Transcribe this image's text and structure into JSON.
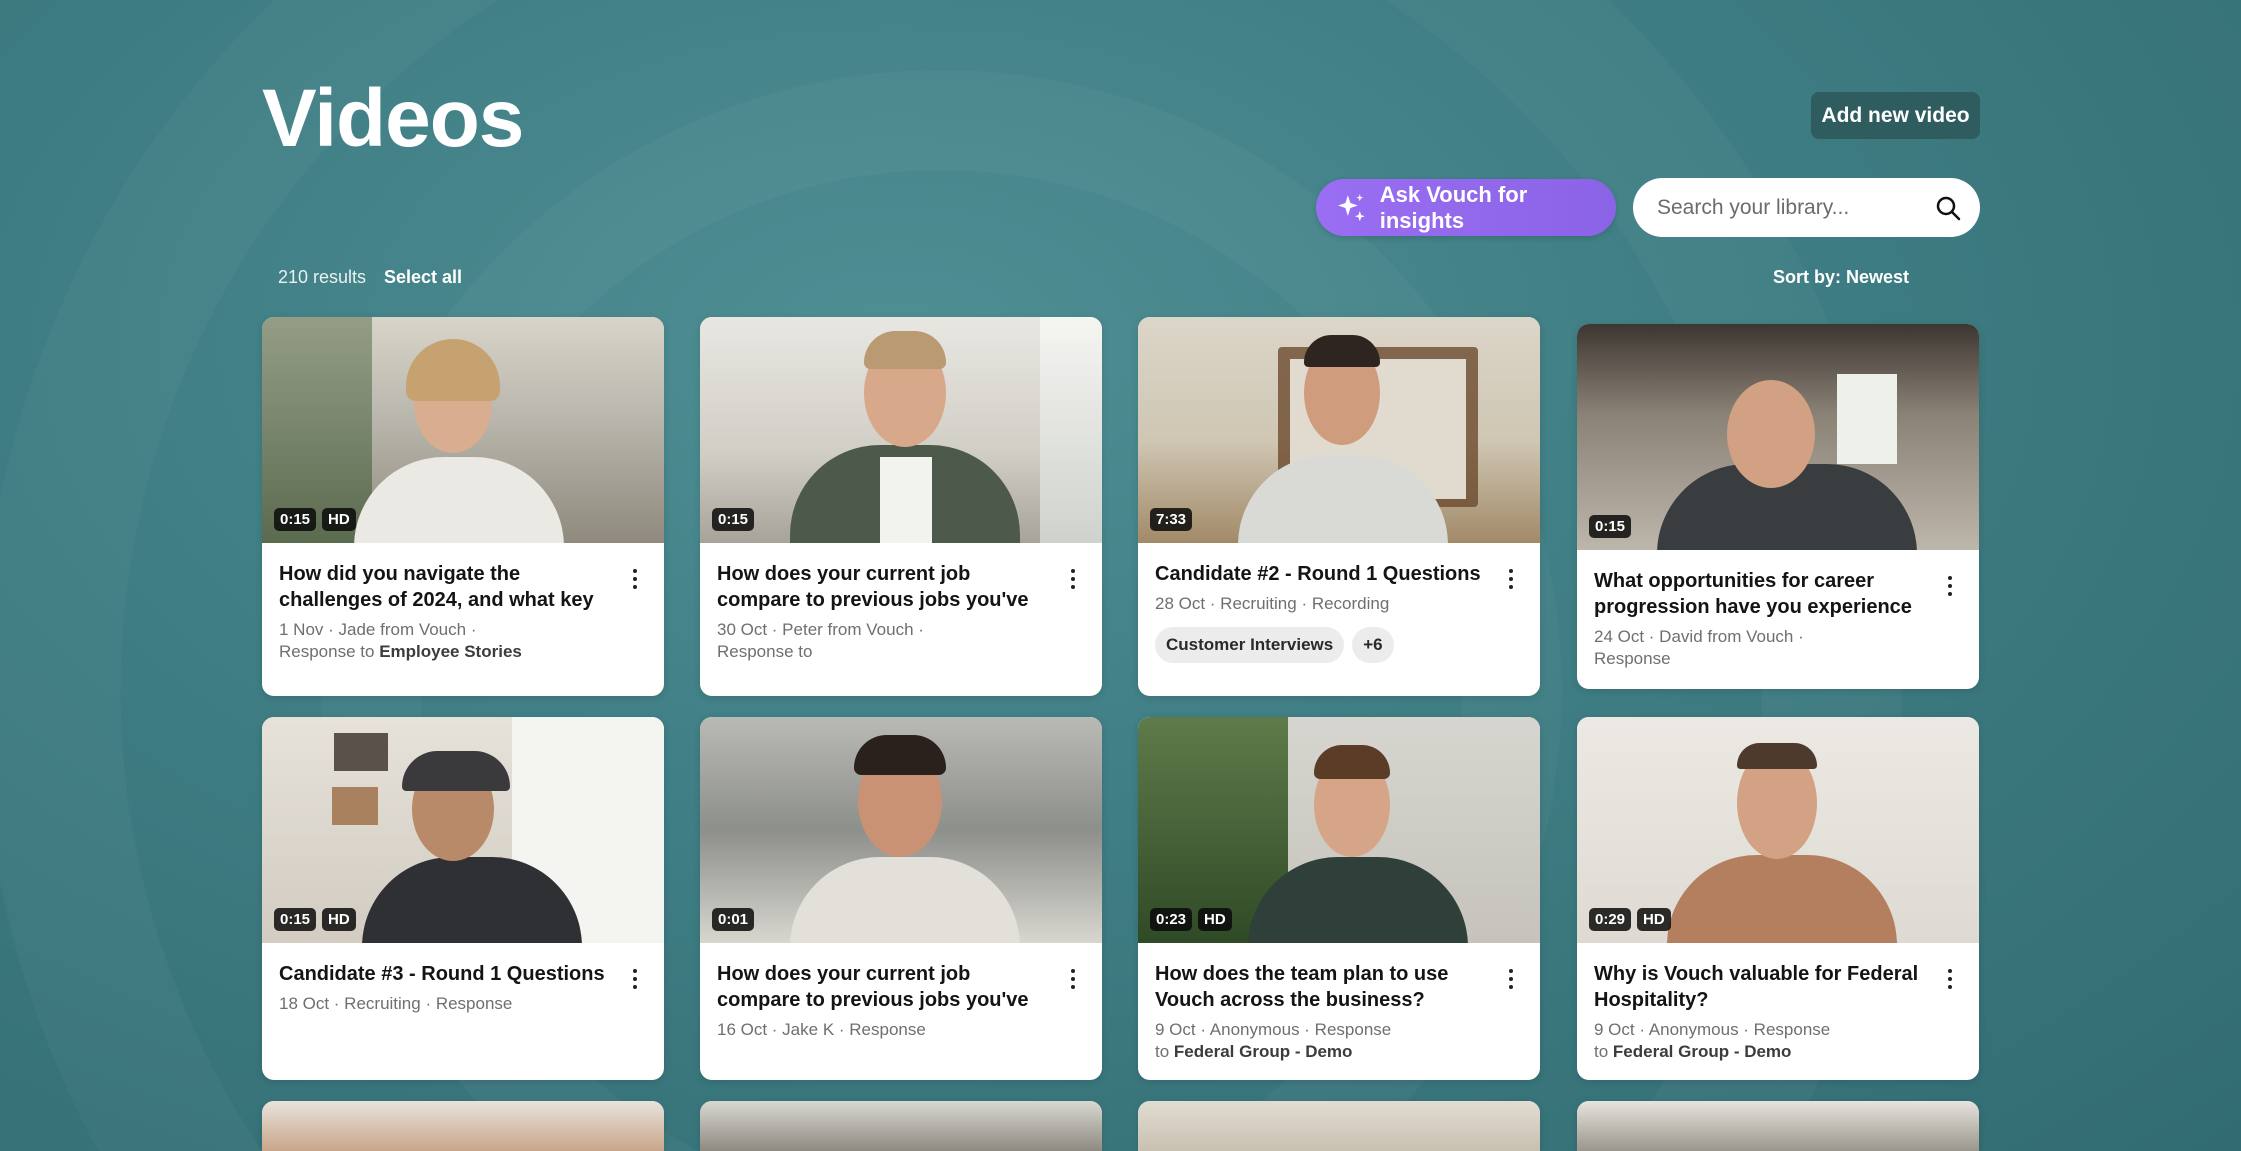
{
  "header": {
    "title": "Videos",
    "add_button": "Add new video",
    "ask_button": "Ask Vouch for insights",
    "search_placeholder": "Search your library..."
  },
  "toolbar": {
    "results": "210 results",
    "select_all": "Select all",
    "sort": "Sort by: Newest"
  },
  "videos": [
    {
      "duration": "0:15",
      "hd": "HD",
      "title": "How did you navigate the challenges of 2024, and what key",
      "meta1": "1 Nov · Jade from Vouch ·",
      "meta2_prefix": "Response to ",
      "meta2_bold": "Employee Stories"
    },
    {
      "duration": "0:15",
      "hd": "",
      "title": "How does your current job compare to previous jobs you've",
      "meta1": "30 Oct · Peter from Vouch ·",
      "meta2_prefix": "Response to",
      "meta2_bold": ""
    },
    {
      "duration": "7:33",
      "hd": "",
      "title": "Candidate #2 -  Round 1 Questions",
      "meta1": "28 Oct · Recruiting · Recording",
      "tags": [
        "Customer Interviews",
        "+6"
      ]
    },
    {
      "duration": "0:15",
      "hd": "",
      "title": "What opportunities for career progression have you experience",
      "meta1": "24 Oct · David from Vouch ·",
      "meta2_prefix": "Response",
      "meta2_bold": ""
    },
    {
      "duration": "0:15",
      "hd": "HD",
      "title": "Candidate #3 -  Round 1 Questions",
      "meta1": "18 Oct · Recruiting · Response"
    },
    {
      "duration": "0:01",
      "hd": "",
      "title": "How does your current job compare to previous jobs you've",
      "meta1": "16 Oct · Jake K · Response"
    },
    {
      "duration": "0:23",
      "hd": "HD",
      "title": "How does the team plan to use Vouch across the business?",
      "meta1": "9 Oct · Anonymous · Response",
      "meta2_prefix": "to ",
      "meta2_bold": "Federal Group - Demo"
    },
    {
      "duration": "0:29",
      "hd": "HD",
      "title": "Why is Vouch valuable for Federal Hospitality?",
      "meta1": "9 Oct · Anonymous · Response",
      "meta2_prefix": "to ",
      "meta2_bold": "Federal Group - Demo"
    }
  ],
  "icons": {
    "ask": "sparkle-icon",
    "search": "search-icon",
    "more": "more-vertical-icon"
  },
  "colors": {
    "background": "#3f7f85",
    "add_button": "#2e5c5f",
    "ask_button": "#9a6ef2"
  }
}
